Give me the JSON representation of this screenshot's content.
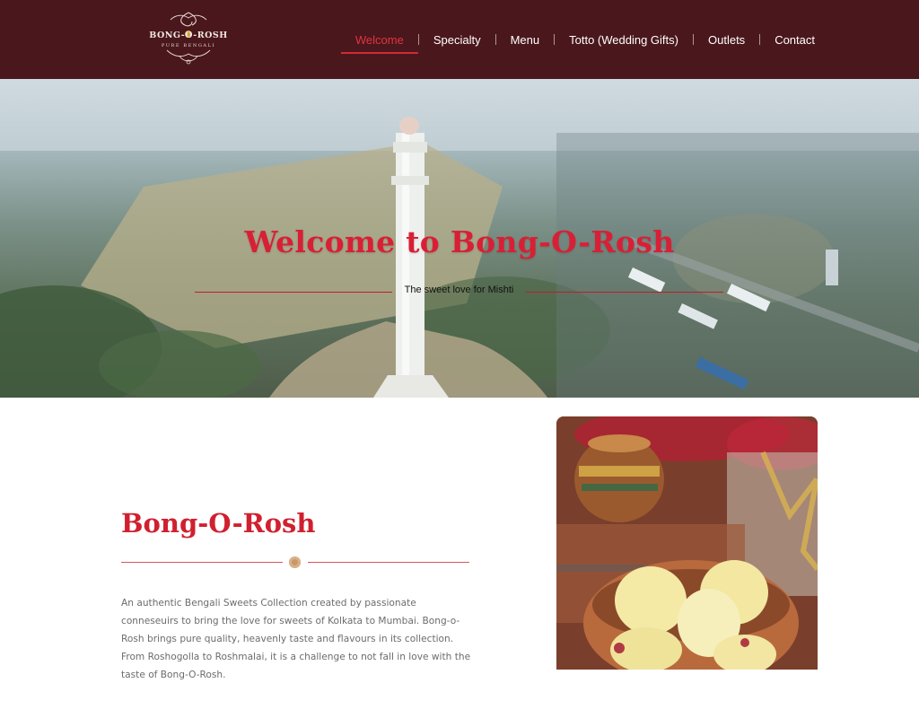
{
  "brand": {
    "logo_text": "BONG-O-ROSH",
    "logo_subtext": "PURE BENGALI",
    "accent_color": "#d0202f",
    "header_color": "#4a171d"
  },
  "nav": {
    "items": [
      {
        "label": "Welcome",
        "active": true
      },
      {
        "label": "Specialty",
        "active": false
      },
      {
        "label": "Menu",
        "active": false
      },
      {
        "label": "Totto (Wedding Gifts)",
        "active": false
      },
      {
        "label": "Outlets",
        "active": false
      },
      {
        "label": "Contact",
        "active": false
      }
    ]
  },
  "hero": {
    "title": "Welcome to Bong-O-Rosh",
    "tagline": "The sweet love for Mishti"
  },
  "about": {
    "title": "Bong-O-Rosh",
    "description": "An authentic Bengali Sweets Collection created by passionate conneseuirs to bring the love for sweets of Kolkata to Mumbai. Bong-o-Rosh brings pure quality, heavenly taste and flavours in its collection. From Roshogolla to Roshmalai, it is a challenge to not fall in love with the taste of Bong-O-Rosh."
  }
}
